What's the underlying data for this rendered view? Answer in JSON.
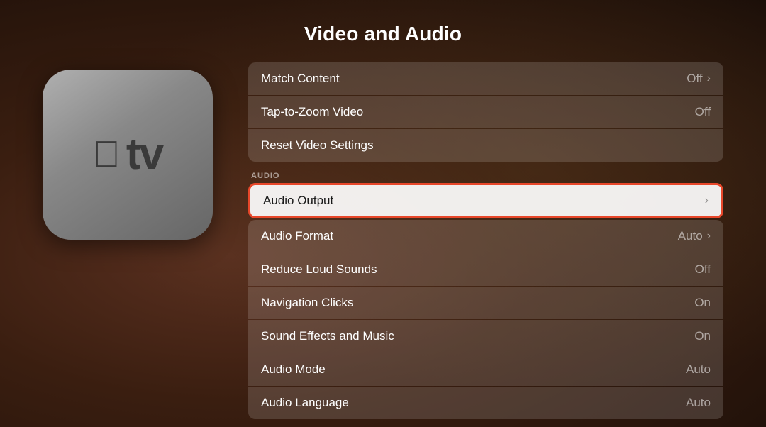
{
  "page": {
    "title": "Video and Audio"
  },
  "sections": {
    "video_section_label": null,
    "audio_section_label": "AUDIO"
  },
  "video_rows": [
    {
      "id": "match-content",
      "label": "Match Content",
      "value": "Off",
      "has_chevron": true,
      "focused": false
    },
    {
      "id": "tap-to-zoom",
      "label": "Tap-to-Zoom Video",
      "value": "Off",
      "has_chevron": false,
      "focused": false
    },
    {
      "id": "reset-video",
      "label": "Reset Video Settings",
      "value": "",
      "has_chevron": false,
      "focused": false
    }
  ],
  "audio_rows": [
    {
      "id": "audio-output",
      "label": "Audio Output",
      "value": "",
      "has_chevron": true,
      "focused": true
    },
    {
      "id": "audio-format",
      "label": "Audio Format",
      "value": "Auto",
      "has_chevron": true,
      "focused": false
    },
    {
      "id": "reduce-loud",
      "label": "Reduce Loud Sounds",
      "value": "Off",
      "has_chevron": false,
      "focused": false
    },
    {
      "id": "navigation-clicks",
      "label": "Navigation Clicks",
      "value": "On",
      "has_chevron": false,
      "focused": false
    },
    {
      "id": "sound-effects",
      "label": "Sound Effects and Music",
      "value": "On",
      "has_chevron": false,
      "focused": false
    },
    {
      "id": "audio-mode",
      "label": "Audio Mode",
      "value": "Auto",
      "has_chevron": false,
      "focused": false
    },
    {
      "id": "audio-language",
      "label": "Audio Language",
      "value": "Auto",
      "has_chevron": false,
      "focused": false
    }
  ],
  "apple_tv": {
    "logo": "",
    "text": "tv"
  }
}
